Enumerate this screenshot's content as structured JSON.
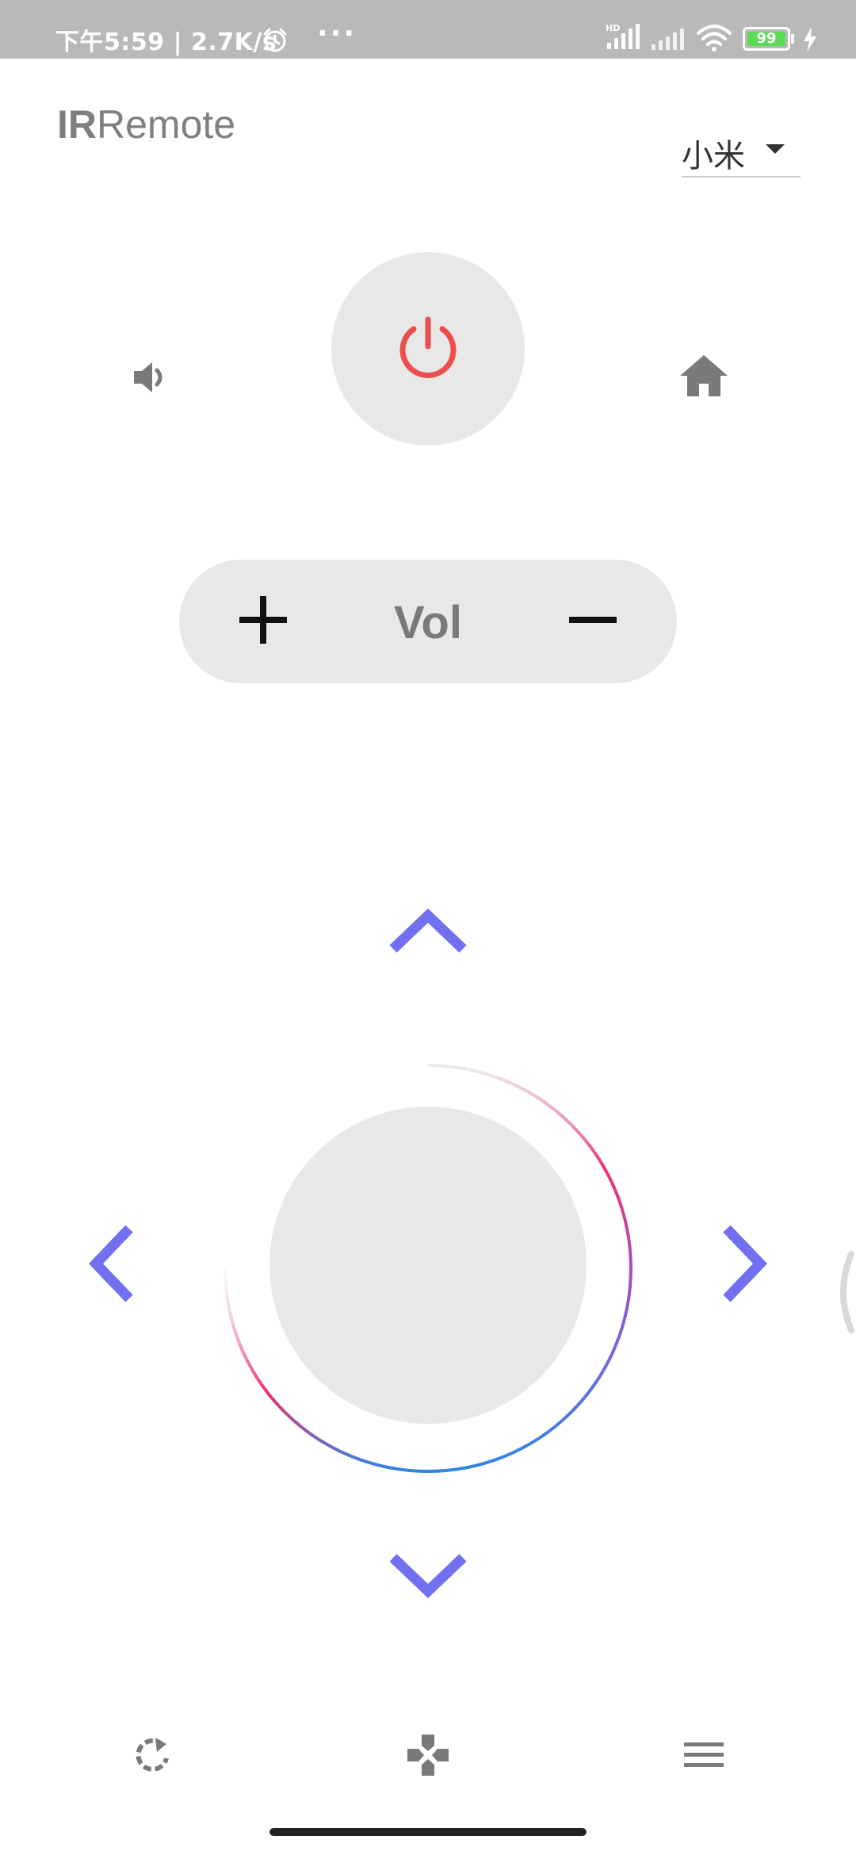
{
  "status_bar": {
    "time": "下午5:59",
    "net_speed": "2.7K/s",
    "dots": "···",
    "network_label": "HD",
    "battery_level": "99",
    "colors": {
      "background": "#b9b9b9",
      "battery_fill": "#5bdc55"
    }
  },
  "header": {
    "title_bold": "IR",
    "title_regular": "Remote",
    "brand_selected": "小米"
  },
  "controls": {
    "power_icon": "power-icon",
    "mute_icon": "volume-icon",
    "home_icon": "home-icon",
    "volume": {
      "label": "Vol",
      "plus_icon": "plus-icon",
      "minus_icon": "minus-icon"
    },
    "dpad": {
      "up_icon": "chevron-up-icon",
      "down_icon": "chevron-down-icon",
      "left_icon": "chevron-left-icon",
      "right_icon": "chevron-right-icon",
      "ok_icon": "ok-button"
    }
  },
  "bottom_bar": {
    "items": [
      {
        "icon": "refresh-icon"
      },
      {
        "icon": "gamepad-icon"
      },
      {
        "icon": "menu-icon"
      }
    ]
  },
  "colors": {
    "accent": "#7070f0",
    "power": "#ec4d4d",
    "button_bg": "#e8e8e8",
    "icon_gray": "#7a7a7a",
    "ring_gradient": [
      "#f0306f",
      "#2f86e8"
    ]
  }
}
